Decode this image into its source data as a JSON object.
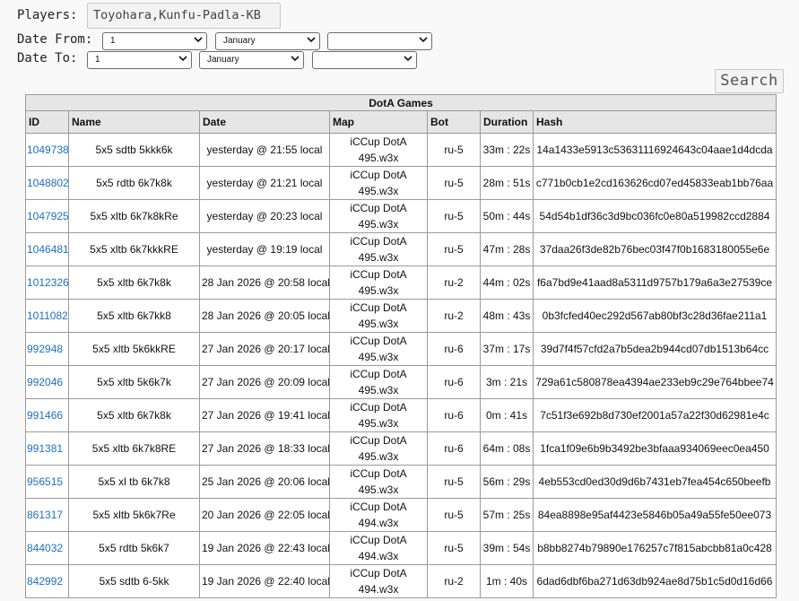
{
  "filters": {
    "players_label": "Players:",
    "players_value": "Toyohara,Kunfu-Padla-KB",
    "date_from_label": "Date From:",
    "date_to_label": "Date To:",
    "from": {
      "day": "1",
      "month": "January",
      "year": ""
    },
    "to": {
      "day": "1",
      "month": "January",
      "year": ""
    },
    "search_label": "Search"
  },
  "table": {
    "caption": "DotA Games",
    "columns": [
      "ID",
      "Name",
      "Date",
      "Map",
      "Bot",
      "Duration",
      "Hash"
    ],
    "rows": [
      {
        "id": "1049738",
        "name": "5x5 sdtb 5kkk6k",
        "date": "yesterday @ 21:55 local",
        "map1": "iCCup DotA",
        "map2": "495.w3x",
        "bot": "ru-5",
        "duration": "33m : 22s",
        "hash": "14a1433e5913c53631116924643c04aae1d4dcda"
      },
      {
        "id": "1048802",
        "name": "5x5 rdtb 6k7k8k",
        "date": "yesterday @ 21:21 local",
        "map1": "iCCup DotA",
        "map2": "495.w3x",
        "bot": "ru-5",
        "duration": "28m : 51s",
        "hash": "c771b0cb1e2cd163626cd07ed45833eab1bb76aa"
      },
      {
        "id": "1047925",
        "name": "5x5 xltb 6k7k8kRe",
        "date": "yesterday @ 20:23 local",
        "map1": "iCCup DotA",
        "map2": "495.w3x",
        "bot": "ru-5",
        "duration": "50m : 44s",
        "hash": "54d54b1df36c3d9bc036fc0e80a519982ccd2884"
      },
      {
        "id": "1046481",
        "name": "5x5 xltb 6k7kkkRE",
        "date": "yesterday @ 19:19 local",
        "map1": "iCCup DotA",
        "map2": "495.w3x",
        "bot": "ru-5",
        "duration": "47m : 28s",
        "hash": "37daa26f3de82b76bec03f47f0b1683180055e6e"
      },
      {
        "id": "1012326",
        "name": "5x5 xltb 6k7k8k",
        "date": "28 Jan 2026 @ 20:58 local",
        "map1": "iCCup DotA",
        "map2": "495.w3x",
        "bot": "ru-2",
        "duration": "44m : 02s",
        "hash": "f6a7bd9e41aad8a5311d9757b179a6a3e27539ce"
      },
      {
        "id": "1011082",
        "name": "5x5 xltb 6k7kk8",
        "date": "28 Jan 2026 @ 20:05 local",
        "map1": "iCCup DotA",
        "map2": "495.w3x",
        "bot": "ru-2",
        "duration": "48m : 43s",
        "hash": "0b3fcfed40ec292d567ab80bf3c28d36fae211a1"
      },
      {
        "id": "992948",
        "name": "5x5 xltb 5k6kkRE",
        "date": "27 Jan 2026 @ 20:17 local",
        "map1": "iCCup DotA",
        "map2": "495.w3x",
        "bot": "ru-6",
        "duration": "37m : 17s",
        "hash": "39d7f4f57cfd2a7b5dea2b944cd07db1513b64cc"
      },
      {
        "id": "992046",
        "name": "5x5 xltb 5k6k7k",
        "date": "27 Jan 2026 @ 20:09 local",
        "map1": "iCCup DotA",
        "map2": "495.w3x",
        "bot": "ru-6",
        "duration": "3m : 21s",
        "hash": "729a61c580878ea4394ae233eb9c29e764bbee74"
      },
      {
        "id": "991466",
        "name": "5x5 xltb 6k7k8k",
        "date": "27 Jan 2026 @ 19:41 local",
        "map1": "iCCup DotA",
        "map2": "495.w3x",
        "bot": "ru-6",
        "duration": "0m : 41s",
        "hash": "7c51f3e692b8d730ef2001a57a22f30d62981e4c"
      },
      {
        "id": "991381",
        "name": "5x5 xltb 6k7k8RE",
        "date": "27 Jan 2026 @ 18:33 local",
        "map1": "iCCup DotA",
        "map2": "495.w3x",
        "bot": "ru-6",
        "duration": "64m : 08s",
        "hash": "1fca1f09e6b9b3492be3bfaaa934069eec0ea450"
      },
      {
        "id": "956515",
        "name": "5x5 xl tb 6k7k8",
        "date": "25 Jan 2026 @ 20:06 local",
        "map1": "iCCup DotA",
        "map2": "495.w3x",
        "bot": "ru-5",
        "duration": "56m : 29s",
        "hash": "4eb553cd0ed30d9d6b7431eb7fea454c650beefb"
      },
      {
        "id": "861317",
        "name": "5x5 xltb 5k6k7Re",
        "date": "20 Jan 2026 @ 22:05 local",
        "map1": "iCCup DotA",
        "map2": "494.w3x",
        "bot": "ru-5",
        "duration": "57m : 25s",
        "hash": "84ea8898e95af4423e5846b05a49a55fe50ee073"
      },
      {
        "id": "844032",
        "name": "5x5 rdtb 5k6k7",
        "date": "19 Jan 2026 @ 22:43 local",
        "map1": "iCCup DotA",
        "map2": "494.w3x",
        "bot": "ru-5",
        "duration": "39m : 54s",
        "hash": "b8bb8274b79890e176257c7f815abcbb81a0c428"
      },
      {
        "id": "842992",
        "name": "5x5 sdtb 6-5kk",
        "date": "19 Jan 2026 @ 22:40 local",
        "map1": "iCCup DotA",
        "map2": "494.w3x",
        "bot": "ru-2",
        "duration": "1m : 40s",
        "hash": "6dad6dbf6ba271d63db924ae8d75b1c5d0d16d66"
      }
    ]
  }
}
